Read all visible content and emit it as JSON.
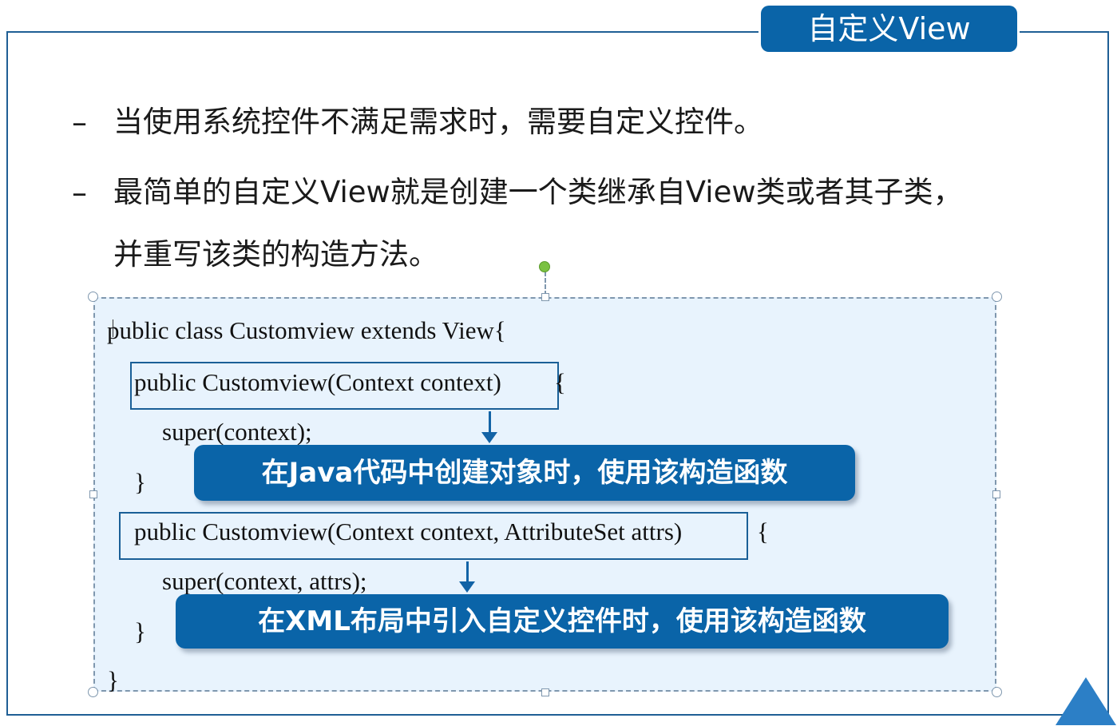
{
  "slide": {
    "title": "自定义View"
  },
  "bullets": [
    {
      "dash": "–",
      "lines": [
        "当使用系统控件不满足需求时，需要自定义控件。"
      ]
    },
    {
      "dash": "–",
      "lines": [
        "最简单的自定义View就是创建一个类继承自View类或者其子类，",
        "并重写该类的构造方法。"
      ]
    }
  ],
  "code": {
    "line1": "public class Customview extends View{",
    "ctor1_signature": "public Customview(Context context)",
    "ctor1_brace": "{",
    "ctor1_body": "super(context);",
    "ctor1_close": "}",
    "ctor2_signature": "public Customview(Context context, AttributeSet attrs)",
    "ctor2_brace": "{",
    "ctor2_body": "super(context, attrs);",
    "ctor2_close": "}",
    "class_close": "}"
  },
  "callouts": {
    "first": "在Java代码中创建对象时，使用该构造函数",
    "second": "在XML布局中引入自定义控件时，使用该构造函数"
  },
  "colors": {
    "accent": "#0a64a8",
    "frame": "#1f5f95",
    "code_bg": "#e8f3fd",
    "rotate_handle": "#7ac142"
  }
}
